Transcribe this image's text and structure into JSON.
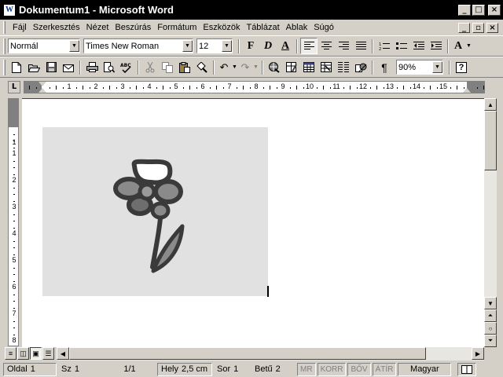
{
  "window": {
    "title": "Dokumentum1 - Microsoft Word",
    "app_icon": "W",
    "controls": [
      "minimize-icon",
      "maximize-icon",
      "close-icon"
    ]
  },
  "menu": {
    "items": [
      {
        "label": "Fájl"
      },
      {
        "label": "Szerkesztés"
      },
      {
        "label": "Nézet"
      },
      {
        "label": "Beszúrás"
      },
      {
        "label": "Formátum"
      },
      {
        "label": "Eszközök"
      },
      {
        "label": "Táblázat"
      },
      {
        "label": "Ablak"
      },
      {
        "label": "Súgó"
      }
    ]
  },
  "formatting": {
    "style": "Normál",
    "font": "Times New Roman",
    "size": "12",
    "bold": "F",
    "italic": "D",
    "underline": "A",
    "font_color": "A"
  },
  "standard": {
    "zoom": "90%",
    "help": "?"
  },
  "ruler": {
    "tab_selector": "L",
    "h_numbers": [
      "1",
      "1",
      "2",
      "3",
      "4",
      "5",
      "6",
      "7",
      "8",
      "9",
      "10",
      "11",
      "12",
      "13",
      "14",
      "15"
    ],
    "v_numbers": [
      "1",
      "1",
      "2",
      "3",
      "4",
      "5",
      "6",
      "7",
      "8"
    ]
  },
  "document": {
    "picture": "flower-drawing",
    "picture_bg": "#e1e1e1",
    "ink": "#3a3a3a",
    "petal_fill": "#8a8a8a"
  },
  "statusbar": {
    "page": "Oldal",
    "page_val": "1",
    "section": "Sz",
    "section_val": "1",
    "pages": "1/1",
    "pos": "Hely",
    "pos_val": "2,5 cm",
    "line": "Sor",
    "line_val": "1",
    "col": "Betű",
    "col_val": "2",
    "rec": "MR",
    "trk": "KORR",
    "ext": "BŐV",
    "ovr": "ÁTÍR",
    "language": "Magyar"
  }
}
